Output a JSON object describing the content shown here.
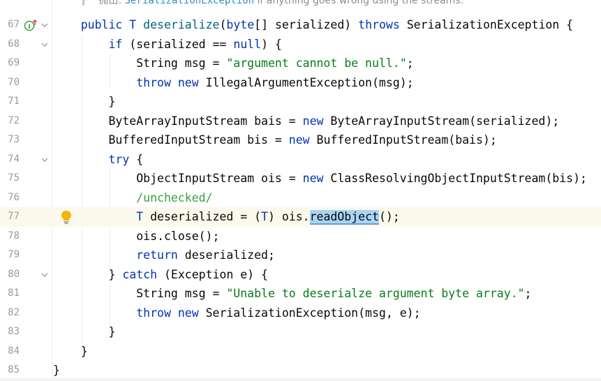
{
  "doc_hint": {
    "prefix": "抛出:",
    "exception": "SerializationException",
    "text": " if anything goes wrong using the streams."
  },
  "lines": [
    {
      "num": "67",
      "fold": true,
      "override_icon": true
    },
    {
      "num": "68",
      "fold": true
    },
    {
      "num": "69"
    },
    {
      "num": "70"
    },
    {
      "num": "71"
    },
    {
      "num": "72"
    },
    {
      "num": "73"
    },
    {
      "num": "74",
      "fold": true
    },
    {
      "num": "75"
    },
    {
      "num": "76"
    },
    {
      "num": "77",
      "current": true,
      "bulb": true
    },
    {
      "num": "78"
    },
    {
      "num": "79"
    },
    {
      "num": "80",
      "fold": true
    },
    {
      "num": "81"
    },
    {
      "num": "82"
    },
    {
      "num": "83"
    },
    {
      "num": "84"
    },
    {
      "num": "85"
    }
  ],
  "code": {
    "l67": {
      "indent": "    ",
      "public": "public ",
      "T": "T ",
      "name": "deserialize",
      "open": "(",
      "byte": "byte",
      "params": "[] serialized) ",
      "throws": "throws",
      "rest": " SerializationException {"
    },
    "l68": {
      "indent": "        ",
      "if": "if",
      "cond1": " (serialized == ",
      "null": "null",
      "cond2": ") {"
    },
    "l69": {
      "indent": "            ",
      "decl": "String msg = ",
      "str": "\"argument cannot be null.\"",
      "end": ";"
    },
    "l70": {
      "indent": "            ",
      "throw": "throw",
      "sp": " ",
      "new": "new",
      "rest": " IllegalArgumentException(msg);"
    },
    "l71": {
      "indent": "        ",
      "rest": "}"
    },
    "l72": {
      "indent": "        ",
      "decl": "ByteArrayInputStream bais = ",
      "new": "new",
      "rest": " ByteArrayInputStream(serialized);"
    },
    "l73": {
      "indent": "        ",
      "decl": "BufferedInputStream bis = ",
      "new": "new",
      "rest": " BufferedInputStream(bais);"
    },
    "l74": {
      "indent": "        ",
      "try": "try",
      "rest": " {"
    },
    "l75": {
      "indent": "            ",
      "decl": "ObjectInputStream ois = ",
      "new": "new",
      "rest": " ClassResolvingObjectInputStream(bis);"
    },
    "l76": {
      "indent": "            ",
      "comment": "/unchecked/"
    },
    "l77": {
      "indent": "            ",
      "T": "T",
      "decl": " deserialized = (",
      "T2": "T",
      "mid": ") ois.",
      "call": "readObject",
      "end": "();"
    },
    "l78": {
      "indent": "            ",
      "rest": "ois.close();"
    },
    "l79": {
      "indent": "            ",
      "return": "return",
      "rest": " deserialized;"
    },
    "l80": {
      "indent": "        ",
      "open": "} ",
      "catch": "catch",
      "rest": " (Exception e) {"
    },
    "l81": {
      "indent": "            ",
      "decl": "String msg = ",
      "str": "\"Unable to deserialze argument byte array.\"",
      "end": ";"
    },
    "l82": {
      "indent": "            ",
      "throw": "throw",
      "sp": " ",
      "new": "new",
      "rest": " SerializationException(msg, e);"
    },
    "l83": {
      "indent": "        ",
      "rest": "}"
    },
    "l84": {
      "indent": "    ",
      "rest": "}"
    },
    "l85": {
      "indent": "",
      "rest": "}"
    }
  },
  "colors": {
    "keyword": "#0033b3",
    "string": "#067d17",
    "comment": "#3c9e41",
    "method_decl": "#00627a",
    "selection": "#a8d4f5",
    "current_line": "#fbf9eb",
    "line_number": "#9a9ba0"
  },
  "icons": {
    "override": "implementing-method-icon",
    "fold": "chevron-down-icon",
    "intention": "lightbulb-icon"
  }
}
